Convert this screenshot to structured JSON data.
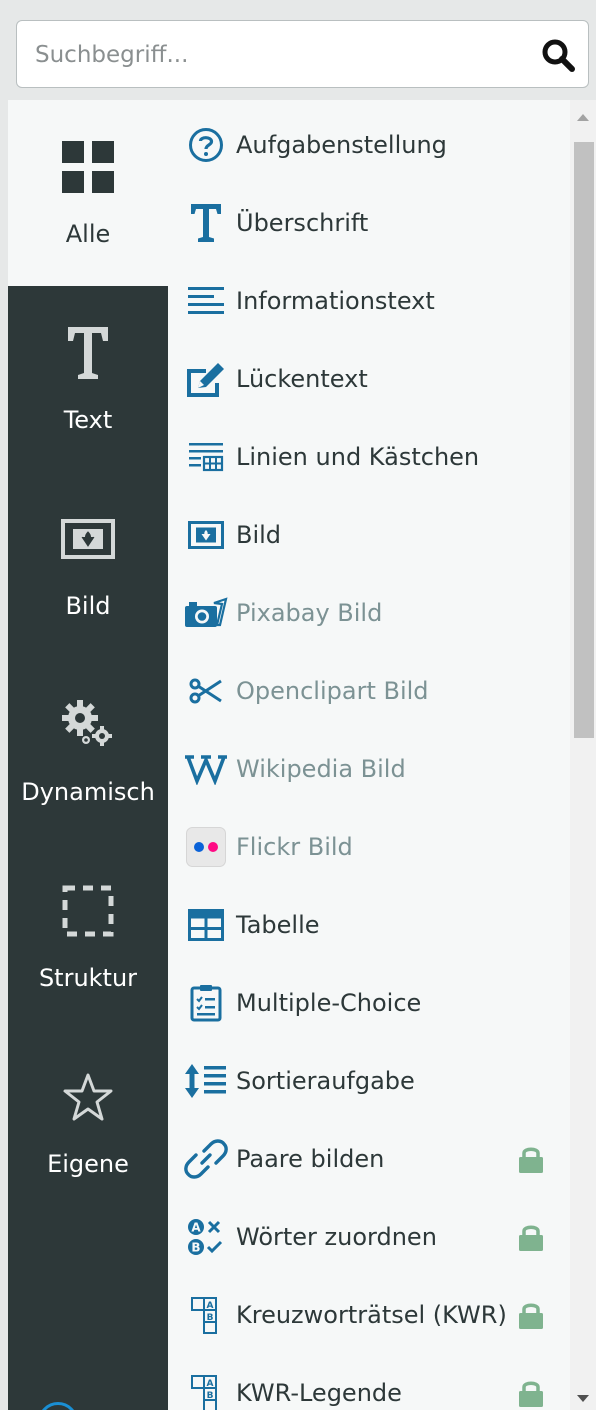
{
  "search": {
    "placeholder": "Suchbegriff..."
  },
  "categories": [
    {
      "label": "Alle",
      "icon": "grid-icon",
      "active": true
    },
    {
      "label": "Text",
      "icon": "text-t-icon"
    },
    {
      "label": "Bild",
      "icon": "image-icon"
    },
    {
      "label": "Dynamisch",
      "icon": "gears-icon"
    },
    {
      "label": "Struktur",
      "icon": "dashed-square-icon"
    },
    {
      "label": "Eigene",
      "icon": "star-icon"
    }
  ],
  "items": [
    {
      "label": "Aufgabenstellung",
      "icon": "question-circle-icon"
    },
    {
      "label": "Überschrift",
      "icon": "heading-t-icon"
    },
    {
      "label": "Informationstext",
      "icon": "paragraph-lines-icon"
    },
    {
      "label": "Lückentext",
      "icon": "pencil-edit-icon"
    },
    {
      "label": "Linien und Kästchen",
      "icon": "lines-boxes-icon"
    },
    {
      "label": "Bild",
      "icon": "image-icon"
    },
    {
      "label": "Pixabay Bild",
      "icon": "camera-icon",
      "dim": true
    },
    {
      "label": "Openclipart Bild",
      "icon": "scissors-icon",
      "dim": true
    },
    {
      "label": "Wikipedia Bild",
      "icon": "wikipedia-w-icon",
      "dim": true
    },
    {
      "label": "Flickr Bild",
      "icon": "flickr-icon",
      "dim": true
    },
    {
      "label": "Tabelle",
      "icon": "table-icon"
    },
    {
      "label": "Multiple-Choice",
      "icon": "clipboard-checklist-icon"
    },
    {
      "label": "Sortieraufgabe",
      "icon": "sort-arrows-icon"
    },
    {
      "label": "Paare bilden",
      "icon": "link-icon",
      "locked": true
    },
    {
      "label": "Wörter zuordnen",
      "icon": "ab-match-icon",
      "locked": true
    },
    {
      "label": "Kreuzworträtsel (KWR)",
      "icon": "crossword-icon",
      "locked": true
    },
    {
      "label": "KWR-Legende",
      "icon": "crossword-icon",
      "locked": true
    }
  ],
  "colors": {
    "sidebar": "#2d3839",
    "icon_blue": "#1a6fa0",
    "lock_green": "#7fb38f",
    "dim_text": "#7c9294"
  }
}
